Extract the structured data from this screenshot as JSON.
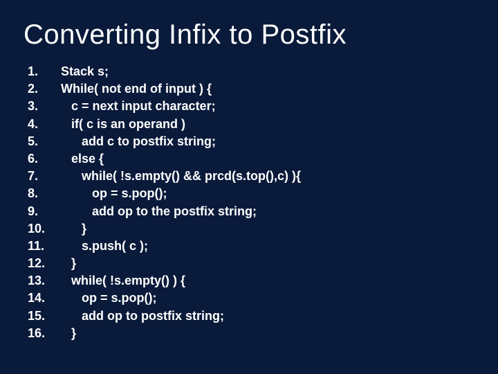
{
  "title": "Converting Infix to Postfix",
  "lines": [
    {
      "n": "1.",
      "t": "Stack s;"
    },
    {
      "n": "2.",
      "t": "While( not end of input ) {"
    },
    {
      "n": "3.",
      "t": "   c = next input character;"
    },
    {
      "n": "4.",
      "t": "   if( c is an operand )"
    },
    {
      "n": "5.",
      "t": "      add c to postfix string;"
    },
    {
      "n": "6.",
      "t": "   else {"
    },
    {
      "n": "7.",
      "t": "      while( !s.empty() && prcd(s.top(),c) ){"
    },
    {
      "n": "8.",
      "t": "         op = s.pop();"
    },
    {
      "n": "9.",
      "t": "         add op to the postfix string;"
    },
    {
      "n": "10.",
      "t": "      }"
    },
    {
      "n": "11.",
      "t": "      s.push( c );"
    },
    {
      "n": "12.",
      "t": "   }"
    },
    {
      "n": "13.",
      "t": "   while( !s.empty() ) {"
    },
    {
      "n": "14.",
      "t": "      op = s.pop();"
    },
    {
      "n": "15.",
      "t": "      add op to postfix string;"
    },
    {
      "n": "16.",
      "t": "   }"
    }
  ]
}
